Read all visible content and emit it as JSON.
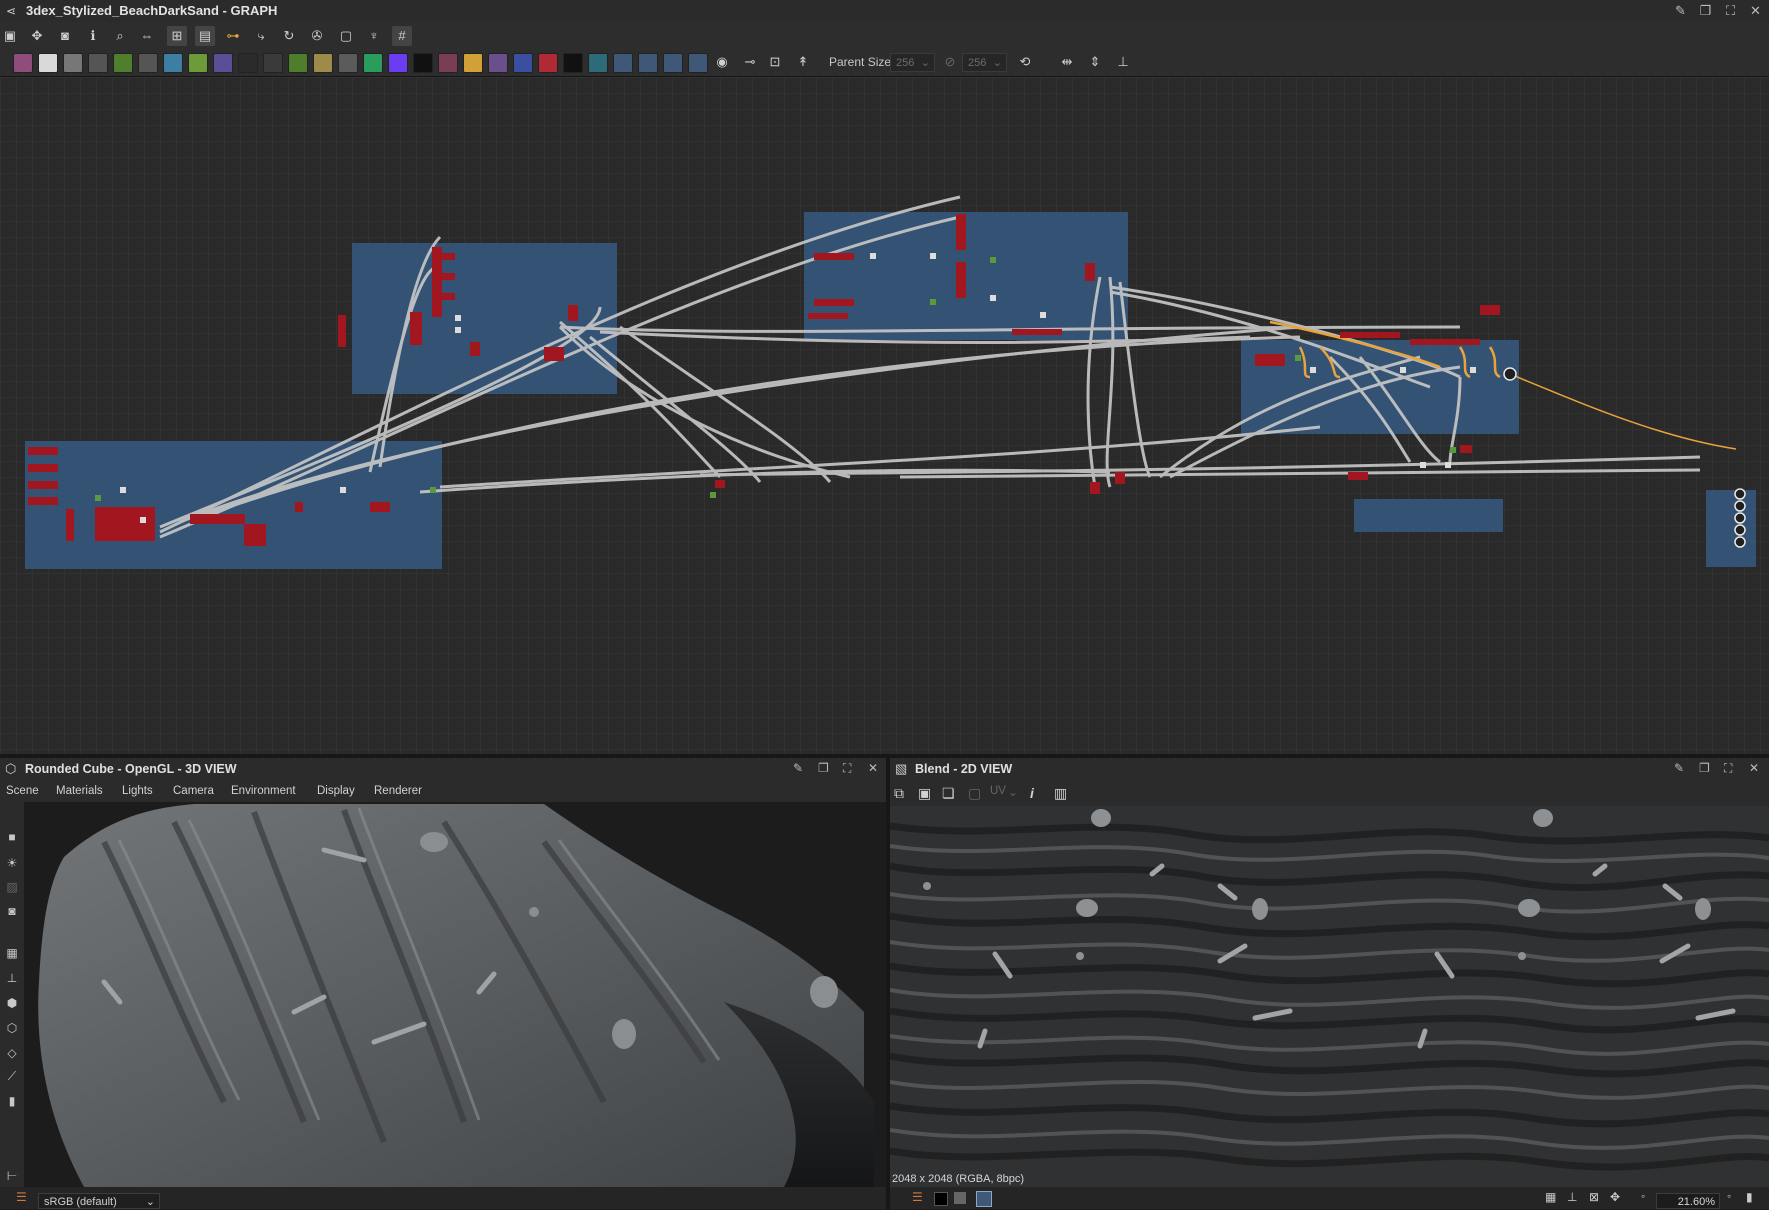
{
  "window": {
    "title": "3dex_Stylized_BeachDarkSand - GRAPH",
    "buttons": [
      "pin-icon",
      "undock-icon",
      "maximize-icon",
      "close-icon"
    ]
  },
  "toolbar_top": {
    "icons": [
      "frame-icon",
      "pan-icon",
      "screenshot-icon",
      "info-icon",
      "zoom-icon",
      "link-icon",
      "hierarchy-icon",
      "layout-icon",
      "connector-icon",
      "branch-icon",
      "refresh-icon",
      "wrench-icon",
      "bake-icon",
      "brush-icon",
      "grid-icon"
    ]
  },
  "toolbar_nodes": {
    "icons": [
      "bitmap-node-icon",
      "svg-node-icon",
      "uniform-color-icon",
      "blend-icon",
      "curve-icon",
      "levels-icon",
      "transform-icon",
      "gradient-icon",
      "warp-icon",
      "blur-icon",
      "histogram-icon",
      "grayscale-icon",
      "normal-icon",
      "hsl-icon",
      "invert-icon",
      "noise-icon",
      "text-icon",
      "fx-map-icon",
      "pixel-processor-icon",
      "fill-icon",
      "value-icon",
      "sbs-graph-icon",
      "sbs-function-icon",
      "sbs-link-icon",
      "output-icon",
      "comment-icon",
      "frame-node-icon",
      "pin-node-icon",
      "navigate-icon"
    ],
    "parent_size_label": "Parent Size:",
    "width_value": "256",
    "height_value": "256",
    "layout_icons": [
      "align-icon",
      "distribute-icon",
      "snap-icon"
    ]
  },
  "graph": {
    "frames_count": 7,
    "link_color": "#c9c9c9",
    "highlight_link_color": "#e8a33a",
    "frame_color": "#35567a",
    "node_color": "#a1161f"
  },
  "view3d": {
    "title": "Rounded Cube - OpenGL - 3D VIEW",
    "menu": [
      "Scene",
      "Materials",
      "Lights",
      "Camera",
      "Environment",
      "Display",
      "Renderer"
    ],
    "color_space": "sRGB (default)",
    "side_icons": [
      "camera-icon",
      "light-icon",
      "image-icon",
      "screenshot-icon",
      "grid-icon",
      "axis-icon",
      "cube-icon",
      "wire-cube-icon",
      "plane-icon",
      "tangent-icon",
      "stats-icon",
      "tree-icon"
    ]
  },
  "view2d": {
    "title": "Blend - 2D VIEW",
    "toolbar": [
      "copy-icon",
      "save-icon",
      "export-icon",
      "fit-icon"
    ],
    "uv_label": "UV",
    "info_label": "i",
    "histogram_label": "histogram-icon",
    "resolution_text": "2048 x 2048 (RGBA, 8bpc)",
    "zoom": "21.60%"
  }
}
